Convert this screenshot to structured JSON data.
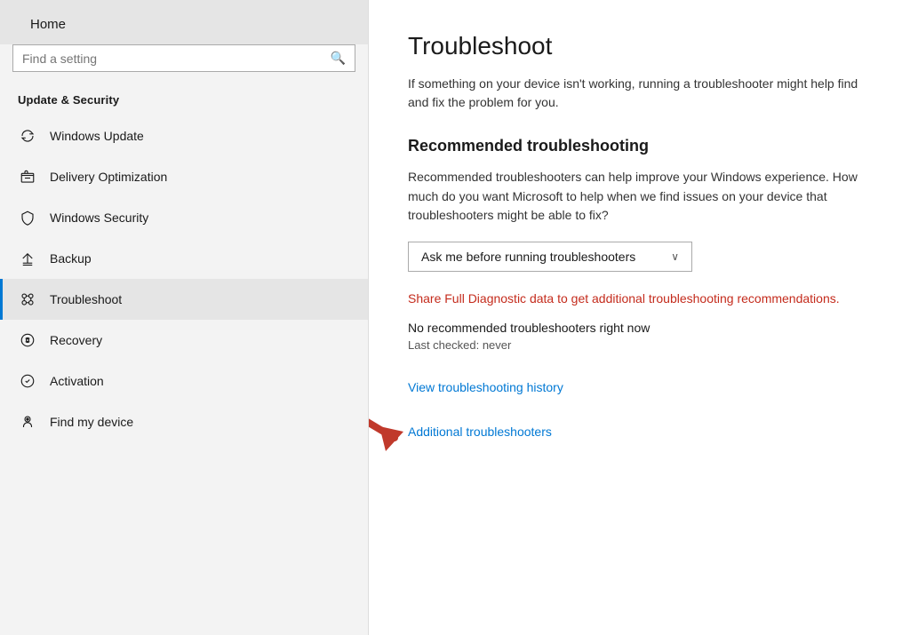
{
  "sidebar": {
    "home_label": "Home",
    "search_placeholder": "Find a setting",
    "section_label": "Update & Security",
    "items": [
      {
        "id": "windows-update",
        "label": "Windows Update",
        "icon": "refresh-icon"
      },
      {
        "id": "delivery-optimization",
        "label": "Delivery Optimization",
        "icon": "delivery-icon"
      },
      {
        "id": "windows-security",
        "label": "Windows Security",
        "icon": "shield-icon"
      },
      {
        "id": "backup",
        "label": "Backup",
        "icon": "backup-icon"
      },
      {
        "id": "troubleshoot",
        "label": "Troubleshoot",
        "icon": "troubleshoot-icon",
        "active": true
      },
      {
        "id": "recovery",
        "label": "Recovery",
        "icon": "recovery-icon"
      },
      {
        "id": "activation",
        "label": "Activation",
        "icon": "activation-icon"
      },
      {
        "id": "find-my-device",
        "label": "Find my device",
        "icon": "find-device-icon"
      }
    ]
  },
  "main": {
    "title": "Troubleshoot",
    "subtitle": "If something on your device isn't working, running a troubleshooter might help find and fix the problem for you.",
    "recommended_section": {
      "title": "Recommended troubleshooting",
      "description": "Recommended troubleshooters can help improve your Windows experience. How much do you want Microsoft to help when we find issues on your device that troubleshooters might be able to fix?",
      "dropdown_value": "Ask me before running troubleshooters",
      "dropdown_chevron": "∨",
      "diagnostic_link": "Share Full Diagnostic data to get additional troubleshooting recommendations.",
      "no_troubleshooters": "No recommended troubleshooters right now",
      "last_checked": "Last checked: never"
    },
    "view_history_link": "View troubleshooting history",
    "additional_link": "Additional troubleshooters"
  }
}
